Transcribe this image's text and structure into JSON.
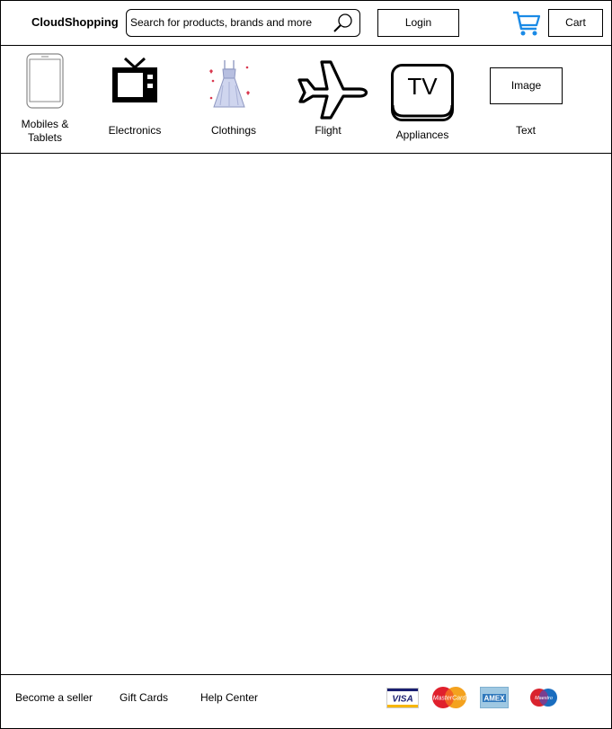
{
  "header": {
    "brand": "CloudShopping",
    "search_placeholder": "Search for products, brands and more",
    "login_label": "Login",
    "cart_label": "Cart"
  },
  "categories": [
    {
      "label": "Mobiles &\nTablets",
      "icon": "mobile-tablet-icon"
    },
    {
      "label": "Electronics",
      "icon": "television-icon"
    },
    {
      "label": "Clothings",
      "icon": "dress-icon"
    },
    {
      "label": "Flight",
      "icon": "airplane-icon"
    },
    {
      "label": "Appliances",
      "icon": "tv-appliance-icon"
    },
    {
      "label": "Text",
      "icon": "image-placeholder",
      "image_label": "Image"
    }
  ],
  "footer": {
    "links": [
      "Become a seller",
      "Gift Cards",
      "Help Center"
    ],
    "payment_methods": [
      {
        "name": "visa-icon",
        "text": "VISA"
      },
      {
        "name": "mastercard-icon",
        "text": "MasterCard"
      },
      {
        "name": "amex-icon",
        "text": "AMEX"
      },
      {
        "name": "maestro-icon",
        "text": "Maestro"
      }
    ]
  },
  "colors": {
    "cart_icon": "#1a8ae6",
    "border": "#000000"
  }
}
